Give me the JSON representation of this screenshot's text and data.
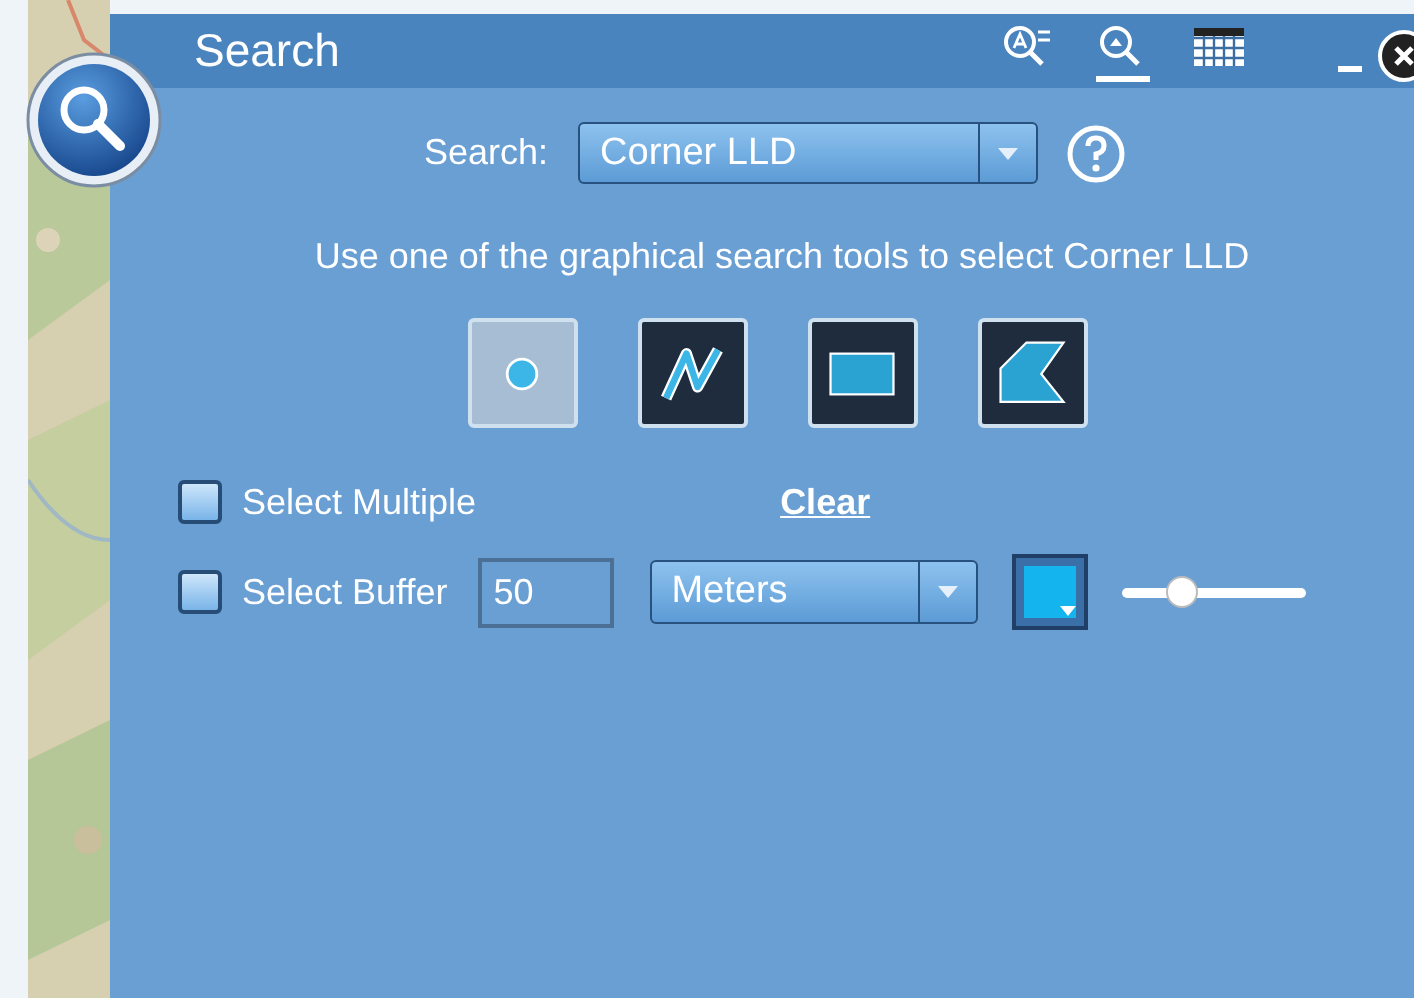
{
  "window": {
    "title": "Search"
  },
  "header_tools": [
    {
      "kind": "text-search",
      "selected": false
    },
    {
      "kind": "location-search",
      "selected": true
    },
    {
      "kind": "table",
      "selected": false
    }
  ],
  "search": {
    "label": "Search:",
    "value": "Corner LLD"
  },
  "instruction": "Use one of the graphical search tools to select Corner LLD",
  "tools": [
    {
      "kind": "point",
      "selected": true
    },
    {
      "kind": "line",
      "selected": false
    },
    {
      "kind": "rectangle",
      "selected": false
    },
    {
      "kind": "polygon",
      "selected": false
    }
  ],
  "select_multiple": {
    "label": "Select Multiple",
    "checked": false
  },
  "clear": "Clear",
  "select_buffer": {
    "label": "Select Buffer",
    "checked": false,
    "value": "50",
    "unit": "Meters",
    "level": 0.33
  }
}
